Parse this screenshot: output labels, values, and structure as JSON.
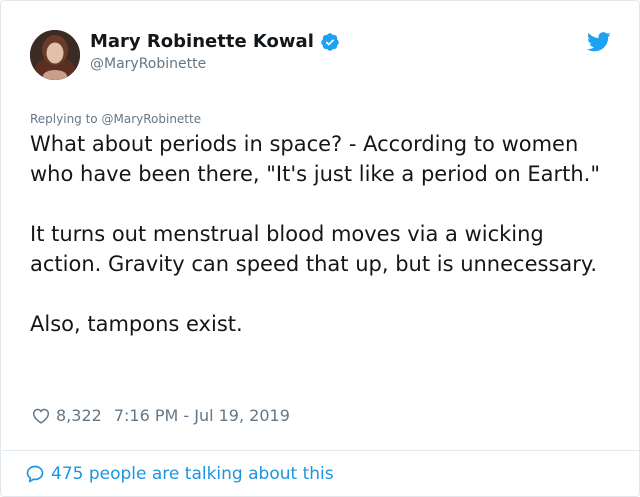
{
  "author": {
    "name": "Mary Robinette Kowal",
    "handle": "@MaryRobinette"
  },
  "icons": {
    "verified": "verified-badge-icon",
    "logo": "twitter-bird-icon",
    "like": "heart-icon",
    "conversation": "speech-bubble-icon"
  },
  "colors": {
    "accent": "#1da1f2",
    "link": "#1b95e0",
    "muted": "#657786",
    "text": "#14171a"
  },
  "tweet": {
    "replying_prefix": "Replying to",
    "replying_to": "@MaryRobinette",
    "paragraphs": [
      "What about periods in space? - According to women who have been there, \"It's just like a period on Earth.\"",
      "It turns out menstrual blood moves via a wicking action. Gravity can speed that up, but is unnecessary.",
      "Also, tampons exist."
    ],
    "likes": "8,322",
    "timestamp": "7:16 PM - Jul 19, 2019"
  },
  "footer": {
    "conversation_text": "475 people are talking about this"
  }
}
